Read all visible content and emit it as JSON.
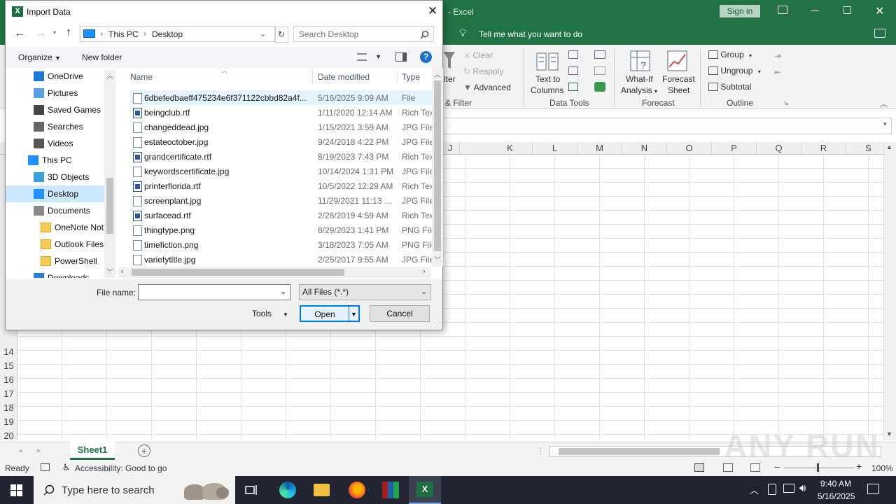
{
  "excel": {
    "title": "- Excel",
    "sign_in": "Sign in",
    "tell_me": "Tell me what you want to do",
    "ribbon": {
      "filter_partial": "lter",
      "clear": "Clear",
      "reapply": "Reapply",
      "advanced": "Advanced",
      "sort_filter_label": "& Filter",
      "text_to_columns_1": "Text to",
      "text_to_columns_2": "Columns",
      "data_tools_label": "Data Tools",
      "what_if_1": "What-If",
      "what_if_2": "Analysis",
      "forecast_sheet_1": "Forecast",
      "forecast_sheet_2": "Sheet",
      "forecast_label": "Forecast",
      "group": "Group",
      "ungroup": "Ungroup",
      "subtotal": "Subtotal",
      "outline_label": "Outline"
    },
    "columns": [
      "J",
      "K",
      "L",
      "M",
      "N",
      "O",
      "P",
      "Q",
      "R",
      "S"
    ],
    "rows": [
      "14",
      "15",
      "16",
      "17",
      "18",
      "19",
      "20"
    ],
    "sheet_tab": "Sheet1",
    "status": {
      "ready": "Ready",
      "accessibility": "Accessibility: Good to go",
      "zoom": "100%"
    },
    "watermark": "ANY RUN"
  },
  "dialog": {
    "title": "Import Data",
    "breadcrumb": [
      "This PC",
      "Desktop"
    ],
    "search_placeholder": "Search Desktop",
    "organize": "Organize",
    "new_folder": "New folder",
    "nav_items": [
      {
        "label": "OneDrive",
        "icon": "onedrive-icon"
      },
      {
        "label": "Pictures",
        "icon": "pictures-icon"
      },
      {
        "label": "Saved Games",
        "icon": "saved-games-icon"
      },
      {
        "label": "Searches",
        "icon": "search-icon"
      },
      {
        "label": "Videos",
        "icon": "videos-icon"
      },
      {
        "label": "This PC",
        "icon": "this-pc-icon"
      },
      {
        "label": "3D Objects",
        "icon": "3d-objects-icon"
      },
      {
        "label": "Desktop",
        "icon": "desktop-icon"
      },
      {
        "label": "Documents",
        "icon": "documents-icon"
      },
      {
        "label": "OneNote Not",
        "icon": "folder-icon"
      },
      {
        "label": "Outlook Files",
        "icon": "folder-icon"
      },
      {
        "label": "PowerShell",
        "icon": "folder-icon"
      },
      {
        "label": "Downloads",
        "icon": "downloads-icon"
      }
    ],
    "columns": {
      "name": "Name",
      "date": "Date modified",
      "type": "Type"
    },
    "files": [
      {
        "name": "6dbefedbaeff475234e6f371122cbbd82a4f...",
        "date": "5/16/2025 9:09 AM",
        "type": "File",
        "kind": "file"
      },
      {
        "name": "beingclub.rtf",
        "date": "1/11/2020 12:14 AM",
        "type": "Rich Text",
        "kind": "rtf"
      },
      {
        "name": "changeddead.jpg",
        "date": "1/15/2021 3:59 AM",
        "type": "JPG File",
        "kind": "img"
      },
      {
        "name": "estateoctober.jpg",
        "date": "9/24/2018 4:22 PM",
        "type": "JPG File",
        "kind": "img"
      },
      {
        "name": "grandcertificate.rtf",
        "date": "8/19/2023 7:43 PM",
        "type": "Rich Text",
        "kind": "rtf"
      },
      {
        "name": "keywordscertificate.jpg",
        "date": "10/14/2024 1:31 PM",
        "type": "JPG File",
        "kind": "img"
      },
      {
        "name": "printerflorida.rtf",
        "date": "10/5/2022 12:29 AM",
        "type": "Rich Text",
        "kind": "rtf"
      },
      {
        "name": "screenplant.jpg",
        "date": "11/29/2021 11:13 ...",
        "type": "JPG File",
        "kind": "img"
      },
      {
        "name": "surfacead.rtf",
        "date": "2/26/2019 4:59 AM",
        "type": "Rich Text",
        "kind": "rtf"
      },
      {
        "name": "thingtype.png",
        "date": "8/29/2023 1:41 PM",
        "type": "PNG File",
        "kind": "img"
      },
      {
        "name": "timefiction.png",
        "date": "3/18/2023 7:05 AM",
        "type": "PNG File",
        "kind": "img"
      },
      {
        "name": "varietytitle.jpg",
        "date": "2/25/2017 9:55 AM",
        "type": "JPG File",
        "kind": "img"
      }
    ],
    "file_name_label": "File name:",
    "file_name_value": "",
    "filter": "All Files (*.*)",
    "tools": "Tools",
    "open": "Open",
    "cancel": "Cancel"
  },
  "taskbar": {
    "search_placeholder": "Type here to search",
    "time": "9:40 AM",
    "date": "5/16/2025"
  },
  "colors": {
    "excel_green": "#217346",
    "selection_blue": "#cce8ff",
    "taskbar": "#1f2430",
    "accent": "#0078d7"
  }
}
